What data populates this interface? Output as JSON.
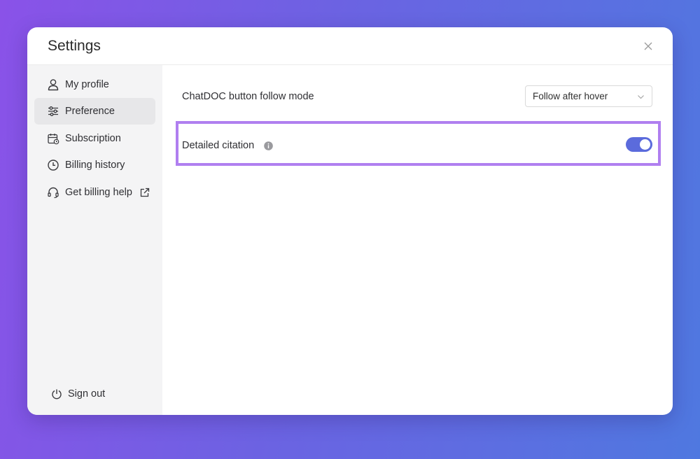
{
  "window": {
    "title": "Settings",
    "close_icon": "close-icon"
  },
  "sidebar": {
    "items": [
      {
        "label": "My profile",
        "icon": "user-icon",
        "active": false
      },
      {
        "label": "Preference",
        "icon": "sliders-icon",
        "active": true
      },
      {
        "label": "Subscription",
        "icon": "calendar-icon",
        "active": false
      },
      {
        "label": "Billing history",
        "icon": "clock-icon",
        "active": false
      },
      {
        "label": "Get billing help",
        "icon": "headset-icon",
        "active": false,
        "trailing_icon": "external-link-icon"
      }
    ],
    "sign_out": {
      "label": "Sign out",
      "icon": "power-icon"
    }
  },
  "preferences": {
    "follow_mode": {
      "label": "ChatDOC button follow mode",
      "value": "Follow after hover"
    },
    "detailed_citation": {
      "label": "Detailed citation",
      "enabled": true,
      "info_icon": "info-icon"
    }
  },
  "colors": {
    "accent": "#5b6bdc",
    "highlight_border": "#b07ff0",
    "background_left": "#8a52e8",
    "background_right": "#4f78e0"
  }
}
